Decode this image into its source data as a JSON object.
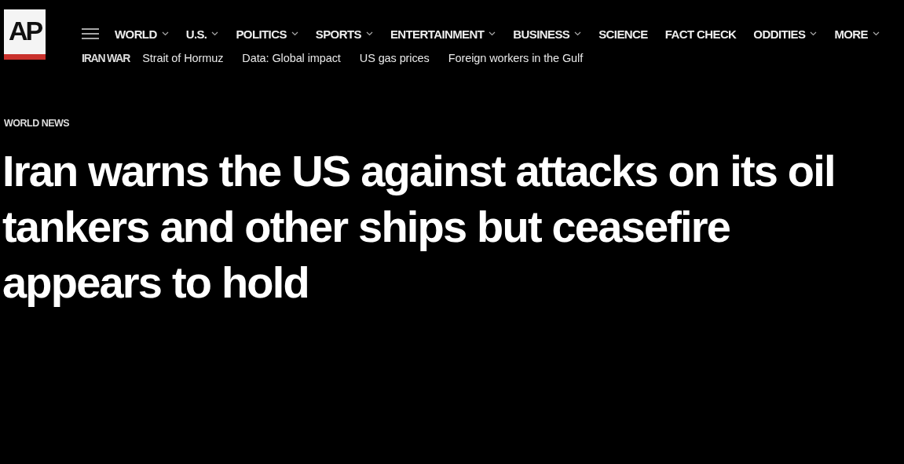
{
  "logo": {
    "text": "AP"
  },
  "nav": [
    {
      "label": "WORLD",
      "has_dropdown": true
    },
    {
      "label": "U.S.",
      "has_dropdown": true
    },
    {
      "label": "POLITICS",
      "has_dropdown": true
    },
    {
      "label": "SPORTS",
      "has_dropdown": true
    },
    {
      "label": "ENTERTAINMENT",
      "has_dropdown": true
    },
    {
      "label": "BUSINESS",
      "has_dropdown": true
    },
    {
      "label": "SCIENCE",
      "has_dropdown": false
    },
    {
      "label": "FACT CHECK",
      "has_dropdown": false
    },
    {
      "label": "ODDITIES",
      "has_dropdown": true
    },
    {
      "label": "MORE",
      "has_dropdown": true
    }
  ],
  "subnav": {
    "label": "IRAN WAR",
    "links": [
      "Strait of Hormuz",
      "Data: Global impact",
      "US gas prices",
      "Foreign workers in the Gulf"
    ]
  },
  "article": {
    "section": "WORLD NEWS",
    "headline": "Iran warns the US against attacks on its oil tankers and other ships but ceasefire appears to hold"
  }
}
